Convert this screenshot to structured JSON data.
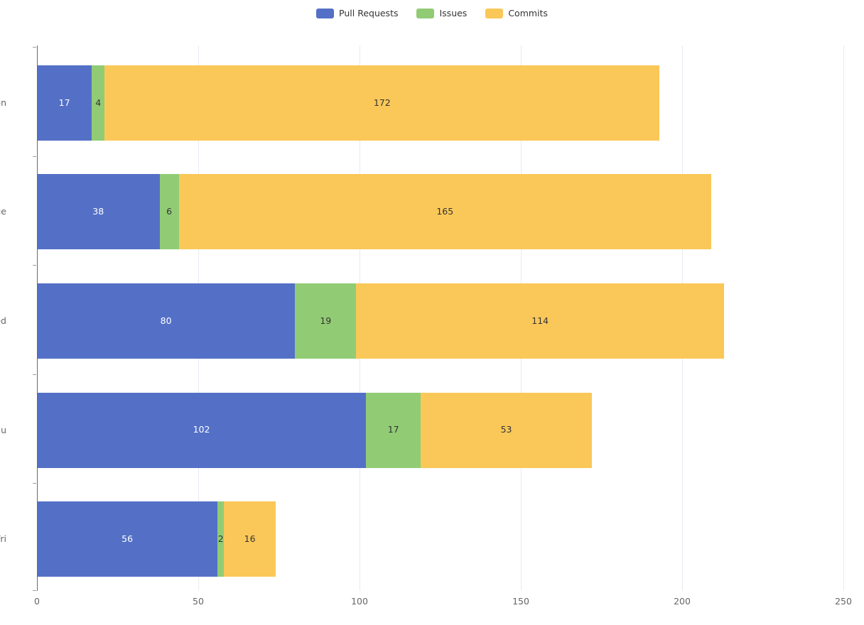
{
  "legend": {
    "position": "top-center",
    "items": [
      {
        "label": "Pull Requests",
        "color": "#5470c6",
        "icon": "legend-swatch"
      },
      {
        "label": "Issues",
        "color": "#91cc75",
        "icon": "legend-swatch"
      },
      {
        "label": "Commits",
        "color": "#fac858",
        "icon": "legend-swatch"
      }
    ]
  },
  "axis": {
    "x_ticks": [
      "0",
      "50",
      "100",
      "150",
      "200",
      "250"
    ],
    "y_ticks": [
      "Mon",
      "Tue",
      "Wed",
      "Thu",
      "Fri"
    ]
  },
  "chart_data": {
    "type": "bar",
    "orientation": "horizontal",
    "stacked": true,
    "title": "",
    "xlabel": "",
    "ylabel": "",
    "xlim": [
      0,
      250
    ],
    "xtick_step": 50,
    "grid": true,
    "legend_position": "top-center",
    "categories": [
      "Mon",
      "Tue",
      "Wed",
      "Thu",
      "Fri"
    ],
    "series": [
      {
        "name": "Pull Requests",
        "color": "#5470c6",
        "label_color": "#ffffff",
        "values": [
          17,
          38,
          80,
          102,
          56
        ]
      },
      {
        "name": "Issues",
        "color": "#91cc75",
        "label_color": "#333333",
        "values": [
          4,
          6,
          19,
          17,
          2
        ]
      },
      {
        "name": "Commits",
        "color": "#fac858",
        "label_color": "#333333",
        "values": [
          172,
          165,
          114,
          53,
          16
        ]
      }
    ],
    "totals": [
      193,
      209,
      213,
      172,
      74
    ]
  },
  "colors": {
    "background": "#ffffff",
    "gridline": "#e6ebf2",
    "axis_line": "#6a6a6a",
    "tick_text": "#666666",
    "label_light": "#ffffff",
    "label_dark": "#333333"
  }
}
